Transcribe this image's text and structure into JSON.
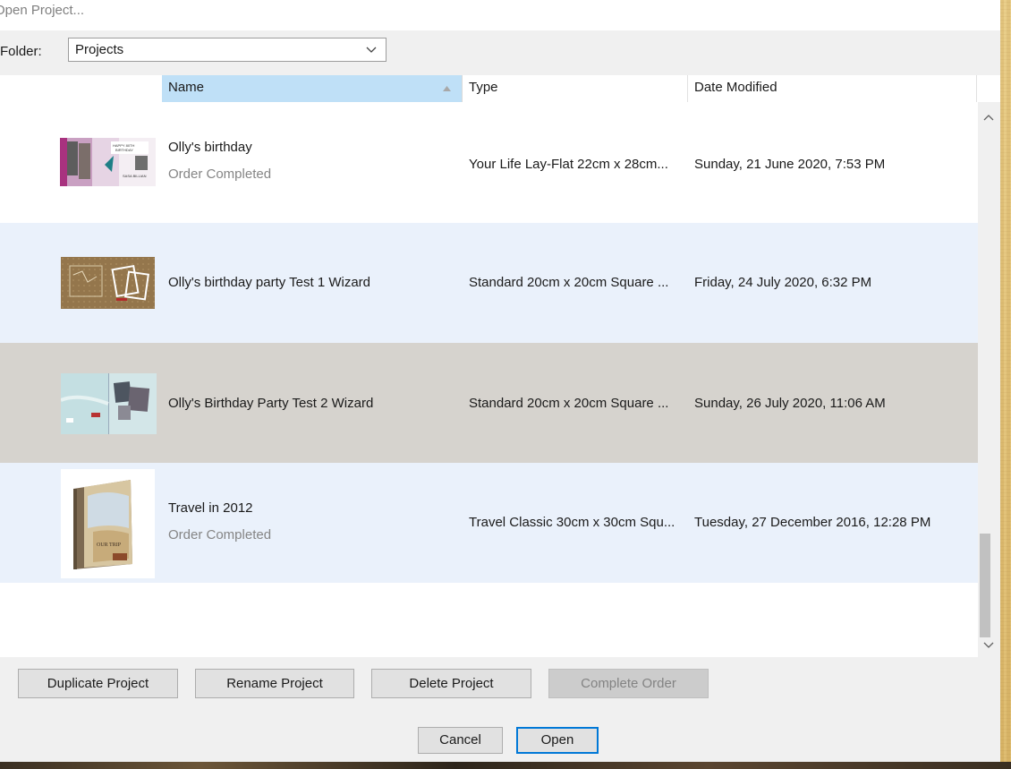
{
  "window": {
    "title": "Open Project..."
  },
  "folder": {
    "label": "Folder:",
    "value": "Projects"
  },
  "columns": {
    "name": "Name",
    "type": "Type",
    "date": "Date Modified"
  },
  "rows": [
    {
      "name": "Olly's birthday",
      "status": "Order Completed",
      "type": "Your Life Lay-Flat 22cm x 28cm...",
      "date": "Sunday, 21 June 2020, 7:53 PM"
    },
    {
      "name": "Olly's birthday party Test 1 Wizard",
      "status": "",
      "type": "Standard 20cm x 20cm Square ...",
      "date": "Friday, 24 July 2020, 6:32 PM"
    },
    {
      "name": "Olly's Birthday Party Test 2 Wizard",
      "status": "",
      "type": "Standard 20cm x 20cm Square ...",
      "date": "Sunday, 26 July 2020, 11:06 AM"
    },
    {
      "name": "Travel in 2012",
      "status": "Order Completed",
      "type": "Travel Classic 30cm x 30cm Squ...",
      "date": "Tuesday, 27 December 2016, 12:28 PM"
    }
  ],
  "thumbnails": {
    "row0": {
      "text_a": "HAPPY 80TH",
      "text_b": "BIRTHDAY",
      "text_c": "SASA BILLIAN"
    },
    "row3": {
      "cover_text": "OUR TRIP"
    }
  },
  "selected_row_index": 2,
  "buttons": {
    "duplicate": "Duplicate Project",
    "rename": "Rename Project",
    "delete": "Delete Project",
    "complete": "Complete Order",
    "cancel": "Cancel",
    "open": "Open"
  },
  "colors": {
    "selected_row": "#d6d3ce",
    "hover_row": "#eaf1fb",
    "sorted_header": "#bfe0f7",
    "default_button_border": "#0078d7"
  },
  "icons": {
    "folder_dropdown": "chevron-down-icon",
    "sort": "sort-ascending-icon",
    "scroll_up": "chevron-up-icon",
    "scroll_down": "chevron-down-icon"
  }
}
